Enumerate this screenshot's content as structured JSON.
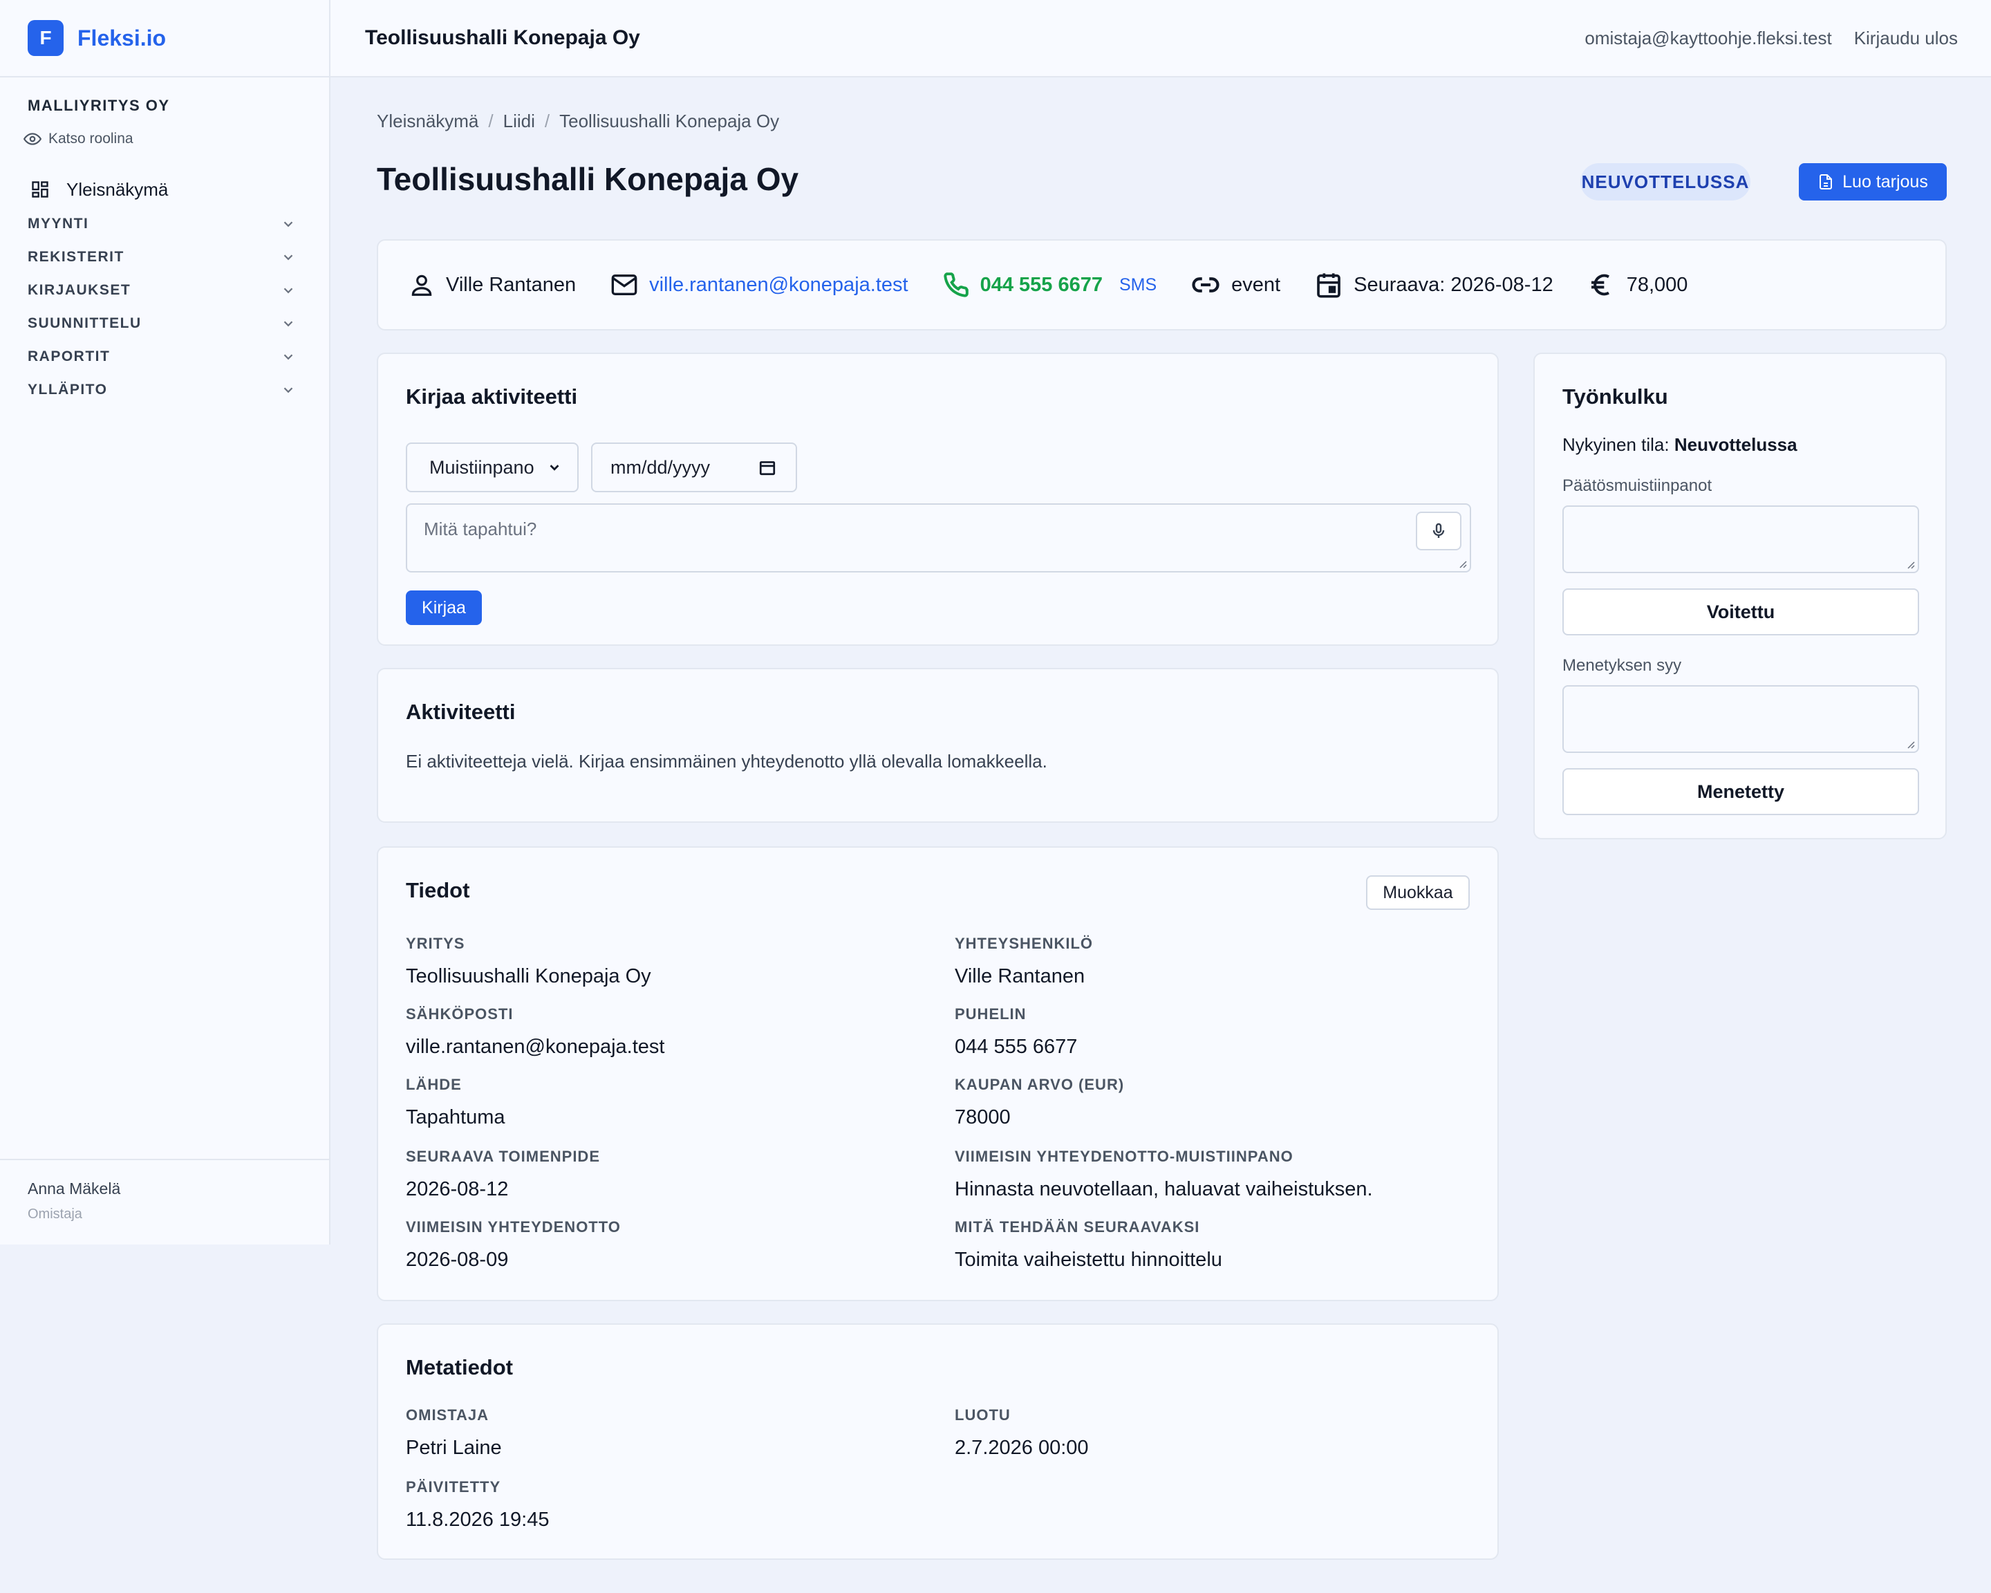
{
  "brand": {
    "logo_letter": "F",
    "name": "Fleksi.io"
  },
  "sidebar": {
    "org_name": "MALLIYRITYS OY",
    "view_role": "Katso roolina",
    "dashboard": "Yleisnäkymä",
    "sections": [
      "MYYNTI",
      "REKISTERIT",
      "KIRJAUKSET",
      "SUUNNITTELU",
      "RAPORTIT",
      "YLLÄPITO"
    ],
    "user_name": "Anna Mäkelä",
    "user_role": "Omistaja"
  },
  "topbar": {
    "title": "Teollisuushalli Konepaja Oy",
    "email": "omistaja@kayttoohje.fleksi.test",
    "logout": "Kirjaudu ulos"
  },
  "breadcrumb": [
    "Yleisnäkymä",
    "Liidi",
    "Teollisuushalli Konepaja Oy"
  ],
  "page": {
    "title": "Teollisuushalli Konepaja Oy",
    "status": "NEUVOTTELUSSA",
    "create_offer": "Luo tarjous"
  },
  "contact": {
    "person": "Ville Rantanen",
    "email": "ville.rantanen@konepaja.test",
    "phone": "044 555 6677",
    "sms": "SMS",
    "source": "event",
    "next": "Seuraava: 2026-08-12",
    "value": "78,000"
  },
  "log": {
    "title": "Kirjaa aktiviteetti",
    "type_selected": "Muistiinpano",
    "date_placeholder": "mm/dd/yyyy",
    "text_placeholder": "Mitä tapahtui?",
    "submit": "Kirjaa"
  },
  "activity": {
    "title": "Aktiviteetti",
    "empty": "Ei aktiviteetteja vielä. Kirjaa ensimmäinen yhteydenotto yllä olevalla lomakkeella."
  },
  "details": {
    "title": "Tiedot",
    "edit": "Muokkaa",
    "fields": [
      {
        "label": "YRITYS",
        "value": "Teollisuushalli Konepaja Oy"
      },
      {
        "label": "YHTEYSHENKILÖ",
        "value": "Ville Rantanen"
      },
      {
        "label": "SÄHKÖPOSTI",
        "value": "ville.rantanen@konepaja.test"
      },
      {
        "label": "PUHELIN",
        "value": "044 555 6677"
      },
      {
        "label": "LÄHDE",
        "value": "Tapahtuma"
      },
      {
        "label": "KAUPAN ARVO (EUR)",
        "value": "78000"
      },
      {
        "label": "SEURAAVA TOIMENPIDE",
        "value": "2026-08-12"
      },
      {
        "label": "VIIMEISIN YHTEYDENOTTO-MUISTIINPANO",
        "value": "Hinnasta neuvotellaan, haluavat vaiheistuksen."
      },
      {
        "label": "VIIMEISIN YHTEYDENOTTO",
        "value": "2026-08-09"
      },
      {
        "label": "MITÄ TEHDÄÄN SEURAAVAKSI",
        "value": "Toimita vaiheistettu hinnoittelu"
      }
    ]
  },
  "meta": {
    "title": "Metatiedot",
    "fields": [
      {
        "label": "OMISTAJA",
        "value": "Petri Laine"
      },
      {
        "label": "LUOTU",
        "value": "2.7.2026 00:00"
      },
      {
        "label": "PÄIVITETTY",
        "value": "11.8.2026 19:45"
      }
    ]
  },
  "workflow": {
    "title": "Työnkulku",
    "state_prefix": "Nykyinen tila:",
    "state": "Neuvottelussa",
    "decision_label": "Päätösmuistiinpanot",
    "won": "Voitettu",
    "loss_label": "Menetyksen syy",
    "lost": "Menetetty"
  },
  "colors": {
    "accent": "#2563eb",
    "phone": "#16a34a",
    "badge_bg": "#dce6fb",
    "badge_text": "#1e40af"
  }
}
